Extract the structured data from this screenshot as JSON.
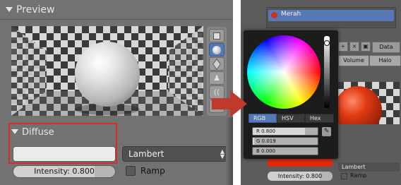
{
  "left_panel": {
    "preview_title": "Preview",
    "diffuse_title": "Diffuse",
    "shader": "Lambert",
    "intensity": "Intensity: 0.800",
    "intensity_fraction": 0.8,
    "ramp_label": "Ramp",
    "color_swatch": "#ebebeb",
    "preview_tools": [
      "flat-square-icon",
      "sphere-icon",
      "cube-icon",
      "monkey-icon",
      "hair-icon",
      "sphere-plane-icon"
    ]
  },
  "right_panel": {
    "material_name": "Merah",
    "material_color": "#c9302c",
    "data_button": "Data",
    "tabs": [
      "Volume",
      "Halo"
    ],
    "shader": "Lambert",
    "intensity": "Intensity: 0.800",
    "intensity_fraction": 0.8,
    "ramp_label": "Ramp",
    "color_swatch": "#e0280c"
  },
  "color_picker": {
    "tabs": [
      "RGB",
      "HSV",
      "Hex"
    ],
    "active_tab": "RGB",
    "r": "R 0.800",
    "g": "G 0.019",
    "b": "B 0.000",
    "r_fraction": 0.8,
    "g_fraction": 0.019,
    "b_fraction": 0.0
  },
  "accent": "#5679b6",
  "highlight_color": "#d82a2a",
  "arrow_color": "#c0392b"
}
